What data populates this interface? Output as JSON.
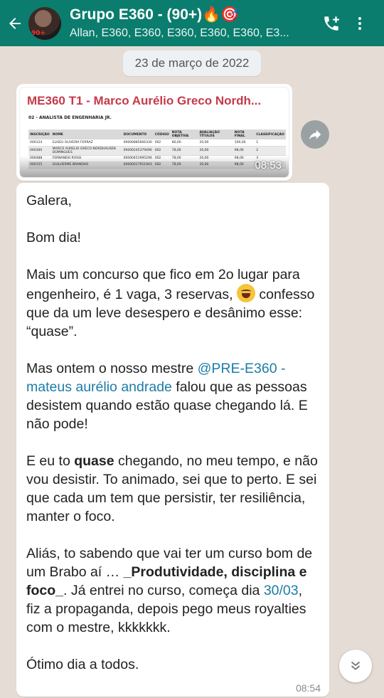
{
  "header": {
    "title": "Grupo E360 - (90+)🔥🎯",
    "subtitle": "Allan, E360, E360, E360, E360, E360, E3...",
    "avatar_badge": "90+"
  },
  "chat": {
    "date": "23 de março de 2022",
    "image_message": {
      "title": "ME360 T1 - Marco Aurélio Greco Nordh...",
      "section": "02 - ANALISTA DE ENGENHARIA JR.",
      "columns": [
        "INSCRIÇÃO",
        "NOME",
        "DOCUMENTO",
        "CÓDIGO",
        "NOTA OBJETIVA",
        "AVALIAÇÃO TÍTULOS",
        "NOTA FINAL",
        "CLASSIFICAÇÃO"
      ],
      "rows": [
        [
          "000124",
          "ELISEU OLIVEIRA FERRAZ",
          "00000885666330",
          "002",
          "80,00",
          "20,00",
          "100,00",
          "1"
        ],
        [
          "000360",
          "MARCO AURELIO GRECO NORDHAUSEN DOMINGUES",
          "00000245379496",
          "002",
          "78,00",
          "20,00",
          "98,00",
          "2"
        ],
        [
          "000488",
          "FERNANDO ROSSI",
          "00000451995296",
          "002",
          "78,00",
          "20,00",
          "98,00",
          "3"
        ],
        [
          "000155",
          "GUILHERME BRANDAO",
          "00000017951943",
          "002",
          "78,00",
          "20,00",
          "98,00",
          "4"
        ]
      ],
      "time": "08:53"
    },
    "text_message": {
      "p1": "Galera,",
      "p2": "Bom dia!",
      "p3a": "Mais um concurso que fico em 2o lugar para engenheiro, é 1 vaga, 3 reservas, ",
      "p3b": " confesso que da um leve desespero e desânimo esse: “quase”.",
      "p4a": "Mas ontem o nosso mestre ",
      "p4_mention": "@PRE-E360 - mateus aurélio andrade",
      "p4b": " falou que as pessoas desistem quando estão quase chegando lá. E não pode!",
      "p5a": "E eu to ",
      "p5_bold": "quase",
      "p5b": " chegando, no meu tempo, e não vou desistir. To animado, sei que to perto. E sei que cada um tem que persistir, ter resiliência, manter o foco.",
      "p6a": "Aliás, to sabendo que vai ter um curso bom de um Brabo aí … ",
      "p6_bold": "_Produtividade, disciplina e foco_",
      "p6b": ". Já entrei no curso, começa dia ",
      "p6_link": "30/03",
      "p6c": ", fiz a propaganda, depois pego meus royalties com o mestre, kkkkkkk.",
      "p7": "Ótimo dia a todos.",
      "time": "08:54"
    }
  },
  "colors": {
    "header": "#0a7d6e",
    "chat_background": "#e5ddd5",
    "mention": "#1c7ca8",
    "doc_title": "#c63a4a"
  },
  "icons": [
    "back-arrow-icon",
    "add-participant-icon",
    "more-options-icon",
    "forward-icon",
    "scroll-down-icon"
  ]
}
